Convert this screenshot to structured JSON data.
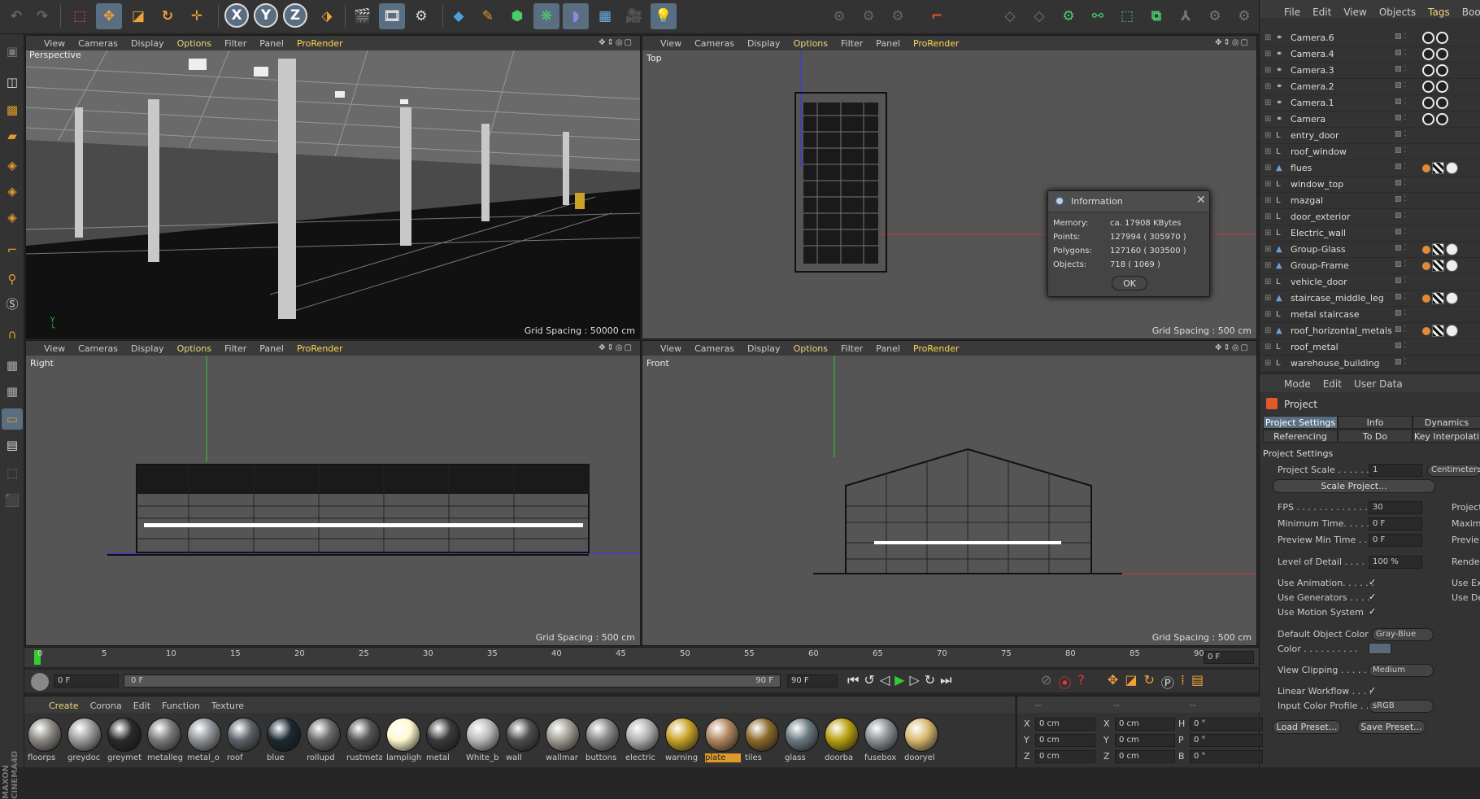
{
  "toolbar": {
    "icons": [
      "undo-icon",
      "redo-icon",
      "live-select-icon",
      "move-icon",
      "scale-icon",
      "rotate-icon",
      "add-object-icon",
      "x-axis-icon",
      "y-axis-icon",
      "z-axis-icon",
      "coordinate-system-icon",
      "render-view-icon",
      "render-picture-viewer-icon",
      "render-settings-icon",
      "cube-icon",
      "pen-icon",
      "subdivision-icon",
      "cloner-icon",
      "deformer-icon",
      "floor-icon",
      "camera-icon",
      "light-icon"
    ],
    "axis": [
      "X",
      "Y",
      "Z"
    ]
  },
  "viewports": [
    {
      "name": "Perspective",
      "grid": "Grid Spacing : 50000 cm"
    },
    {
      "name": "Top",
      "grid": "Grid Spacing : 500 cm"
    },
    {
      "name": "Right",
      "grid": "Grid Spacing : 500 cm"
    },
    {
      "name": "Front",
      "grid": "Grid Spacing : 500 cm"
    }
  ],
  "vpmenu": {
    "view": "View",
    "cameras": "Cameras",
    "display": "Display",
    "options": "Options",
    "filter": "Filter",
    "panel": "Panel",
    "prorender": "ProRender"
  },
  "objmenu": [
    "File",
    "Edit",
    "View",
    "Objects",
    "Tags",
    "Book"
  ],
  "objects": [
    {
      "name": "Camera.6",
      "type": "cam"
    },
    {
      "name": "Camera.4",
      "type": "cam"
    },
    {
      "name": "Camera.3",
      "type": "cam"
    },
    {
      "name": "Camera.2",
      "type": "cam"
    },
    {
      "name": "Camera.1",
      "type": "cam"
    },
    {
      "name": "Camera",
      "type": "cam"
    },
    {
      "name": "entry_door",
      "type": "null"
    },
    {
      "name": "roof_window",
      "type": "null"
    },
    {
      "name": "flues",
      "type": "poly"
    },
    {
      "name": "window_top",
      "type": "null"
    },
    {
      "name": "mazgal",
      "type": "null"
    },
    {
      "name": "door_exterior",
      "type": "null"
    },
    {
      "name": "Electric_wall",
      "type": "null"
    },
    {
      "name": "Group-Glass",
      "type": "poly"
    },
    {
      "name": "Group-Frame",
      "type": "poly"
    },
    {
      "name": "vehicle_door",
      "type": "null"
    },
    {
      "name": "staircase_middle_leg",
      "type": "poly"
    },
    {
      "name": "metal staircase",
      "type": "null"
    },
    {
      "name": "roof_horizontal_metals",
      "type": "poly"
    },
    {
      "name": "roof_metal",
      "type": "null"
    },
    {
      "name": "warehouse_building",
      "type": "null"
    }
  ],
  "attr": {
    "menu": [
      "Mode",
      "Edit",
      "User Data"
    ],
    "title": "Project",
    "tabs1": [
      "Project Settings",
      "Info",
      "Dynamics"
    ],
    "tabs2": [
      "Referencing",
      "To Do",
      "Key Interpolati"
    ],
    "section": "Project Settings",
    "scale_label": "Project Scale . . . . . .",
    "scale_value": "1",
    "scale_unit": "Centimeters",
    "scale_btn": "Scale Project...",
    "fps_label": "FPS . . . . . . . . . . . . . .",
    "fps_value": "30",
    "min_label": "Minimum Time. . . . . .",
    "min_value": "0 F",
    "pmin_label": "Preview Min Time . .",
    "pmin_value": "0 F",
    "right1": "Project",
    "right2": "Maxim",
    "right3": "Previe",
    "right4": "Render",
    "lod_label": "Level of Detail . . . . .",
    "lod_value": "100 %",
    "anim_label": "Use Animation. . . . . .",
    "gen_label": "Use Generators . . . .",
    "motion_label": "Use Motion System",
    "rright1": "Use Exp",
    "rright2": "Use De",
    "doc_label": "Default Object Color",
    "doc_value": "Gray-Blue",
    "color_label": "Color . . . . . . . . . .",
    "clip_label": "View Clipping . . . . .",
    "clip_value": "Medium",
    "lin_label": "Linear Workflow . . . .",
    "icp_label": "Input Color Profile . .",
    "icp_value": "sRGB",
    "load": "Load Preset...",
    "save": "Save Preset...",
    "check": "✓"
  },
  "dialog": {
    "title": "Information",
    "rows": [
      [
        "Memory:",
        "ca. 17908 KBytes"
      ],
      [
        "Points:",
        "127994 ( 305970 )"
      ],
      [
        "Polygons:",
        "127160 ( 303500 )"
      ],
      [
        "Objects:",
        "718 ( 1069 )"
      ]
    ],
    "ok": "OK"
  },
  "timeline": {
    "ticks": [
      "0",
      "5",
      "10",
      "15",
      "20",
      "25",
      "30",
      "35",
      "40",
      "45",
      "50",
      "55",
      "60",
      "65",
      "70",
      "75",
      "80",
      "85",
      "90"
    ],
    "current": "0 F"
  },
  "transport": {
    "start": "0 F",
    "range_start": "0 F",
    "range_end": "90 F",
    "end": "90 F"
  },
  "matmenu": [
    "Create",
    "Corona",
    "Edit",
    "Function",
    "Texture"
  ],
  "materials": [
    {
      "name": "floorps",
      "color": "#8a8780"
    },
    {
      "name": "greydoc",
      "color": "#9a9a9a"
    },
    {
      "name": "greymet",
      "color": "#2a2a2a"
    },
    {
      "name": "metalleg",
      "color": "#7a7a7a"
    },
    {
      "name": "metal_o",
      "color": "#8e9296"
    },
    {
      "name": "roof",
      "color": "#5c6268"
    },
    {
      "name": "blue",
      "color": "#1c2a33"
    },
    {
      "name": "rollupd",
      "color": "#6a6a6a"
    },
    {
      "name": "rustmeta",
      "color": "#555"
    },
    {
      "name": "lamplight",
      "color": "#fff8d0"
    },
    {
      "name": "metal",
      "color": "#3a3a3a"
    },
    {
      "name": "White_b",
      "color": "#b8b8b8"
    },
    {
      "name": "wall",
      "color": "#4d4d4d"
    },
    {
      "name": "wallmar",
      "color": "#a19d94"
    },
    {
      "name": "buttons",
      "color": "#888"
    },
    {
      "name": "electric",
      "color": "#b0b0b0"
    },
    {
      "name": "warning",
      "color": "#c9a227"
    },
    {
      "name": "plate",
      "color": "#b08560"
    },
    {
      "name": "tiles",
      "color": "#8a6a2a"
    },
    {
      "name": "glass",
      "color": "#6a7a80"
    },
    {
      "name": "doorba",
      "color": "#b8a010"
    },
    {
      "name": "fusebox",
      "color": "#8a9094"
    },
    {
      "name": "dooryel",
      "color": "#d8b870"
    }
  ],
  "coords": {
    "labels": [
      "X",
      "Y",
      "Z"
    ],
    "labels2": [
      "X",
      "Y",
      "Z"
    ],
    "labels3": [
      "H",
      "P",
      "B"
    ],
    "val_cm": "0 cm",
    "val_deg": "0 °",
    "header": "--"
  },
  "sidebar_text": "MAXON CINEMA4D"
}
